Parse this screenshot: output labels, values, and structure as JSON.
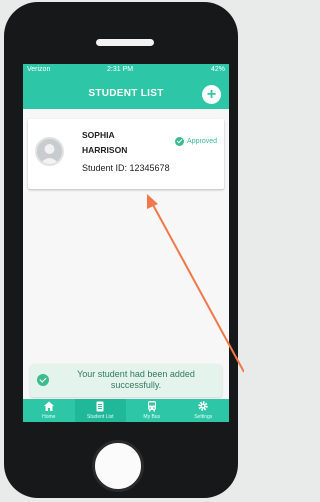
{
  "status_bar": {
    "carrier": "Verizon",
    "time": "2:31 PM",
    "battery": "42%"
  },
  "header": {
    "title": "STUDENT LIST",
    "add_icon": "plus-icon"
  },
  "student": {
    "first_name": "SOPHIA",
    "last_name": "HARRISON",
    "id_text": "Student ID: 12345678",
    "status": "Approved"
  },
  "toast": {
    "message": "Your student had been added successfully."
  },
  "tabs": [
    {
      "label": "Home",
      "icon": "home-icon"
    },
    {
      "label": "Student List",
      "icon": "clipboard-icon",
      "active": true
    },
    {
      "label": "My Bus",
      "icon": "bus-icon"
    },
    {
      "label": "Settings",
      "icon": "gear-icon"
    }
  ],
  "colors": {
    "accent": "#2dc7a7",
    "approved": "#3bbb8f",
    "arrow": "#f0784a",
    "toast_bg": "#e4f4ec"
  }
}
